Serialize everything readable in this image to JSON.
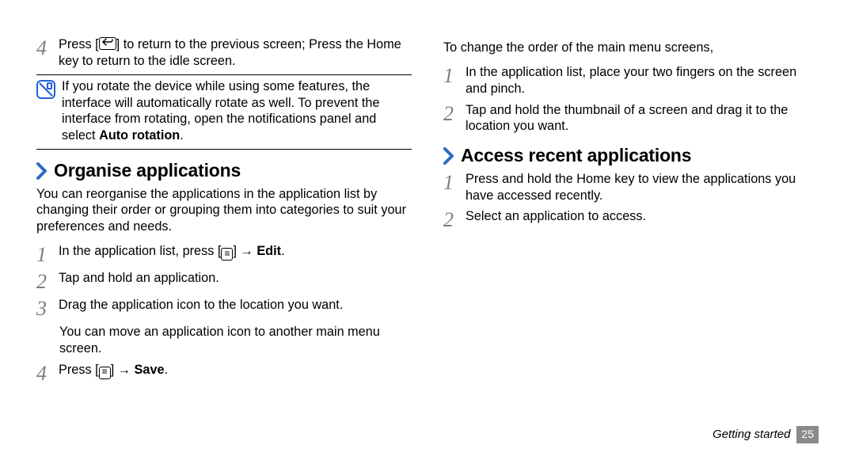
{
  "left": {
    "step4a_a": "Press [",
    "step4a_b": "] to return to the previous screen; Press the Home key to return to the idle screen.",
    "note_line1": "If you rotate the device while using some features, the interface will automatically rotate as well. To prevent the interface from rotating, open the notifications panel and select ",
    "note_bold": "Auto rotation",
    "note_tail": ".",
    "h_org": "Organise applications",
    "org_intro": "You can reorganise the applications in the application list by changing their order or grouping them into categories to suit your preferences and needs.",
    "org_s1_a": "In the application list, press [",
    "org_s1_b": "] → ",
    "org_s1_bold": "Edit",
    "org_s1_c": ".",
    "org_s2": "Tap and hold an application.",
    "org_s3": "Drag the application icon to the location you want.",
    "org_s3_cont": "You can move an application icon to another main menu screen.",
    "org_s4_a": "Press [",
    "org_s4_b": "] → ",
    "org_s4_bold": "Save",
    "org_s4_c": "."
  },
  "right": {
    "reorder_intro": "To change the order of the main menu screens,",
    "re_s1": "In the application list, place your two fingers on the screen and pinch.",
    "re_s2": "Tap and hold the thumbnail of a screen and drag it to the location you want.",
    "h_recent": "Access recent applications",
    "rec_s1": "Press and hold the Home key to view the applications you have accessed recently.",
    "rec_s2": "Select an application to access."
  },
  "footer": {
    "section": "Getting started",
    "page": "25"
  },
  "nums": {
    "n1": "1",
    "n2": "2",
    "n3": "3",
    "n4": "4"
  }
}
